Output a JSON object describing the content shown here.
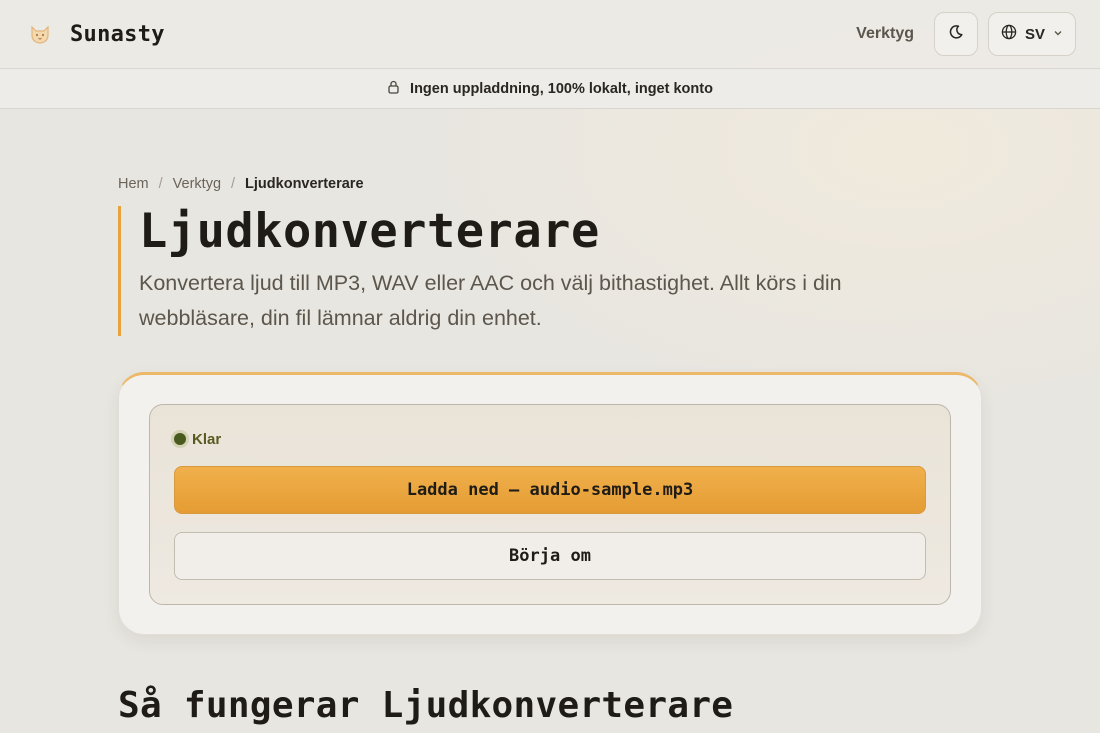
{
  "header": {
    "brand_name": "Sunasty",
    "logo_icon": "fox-icon",
    "nav_link": "Verktyg",
    "theme_icon": "moon-icon",
    "language": "SV"
  },
  "notice": {
    "icon": "lock-icon",
    "text": "Ingen uppladdning, 100% lokalt, inget konto"
  },
  "breadcrumb": {
    "items": [
      "Hem",
      "Verktyg"
    ],
    "separator": "/",
    "current": "Ljudkonverterare"
  },
  "hero": {
    "title": "Ljudkonverterare",
    "description": "Konvertera ljud till MP3, WAV eller AAC och välj bithastighet. Allt körs i din webbläsare, din fil lämnar aldrig din enhet."
  },
  "tool": {
    "status": "Klar",
    "download_label": "Ladda ned — audio-sample.mp3",
    "restart_label": "Börja om"
  },
  "section": {
    "title": "Så fungerar Ljudkonverterare"
  },
  "colors": {
    "accent": "#e8a33e",
    "status_dot": "#4a5a1e",
    "background": "#e8e6e1"
  }
}
